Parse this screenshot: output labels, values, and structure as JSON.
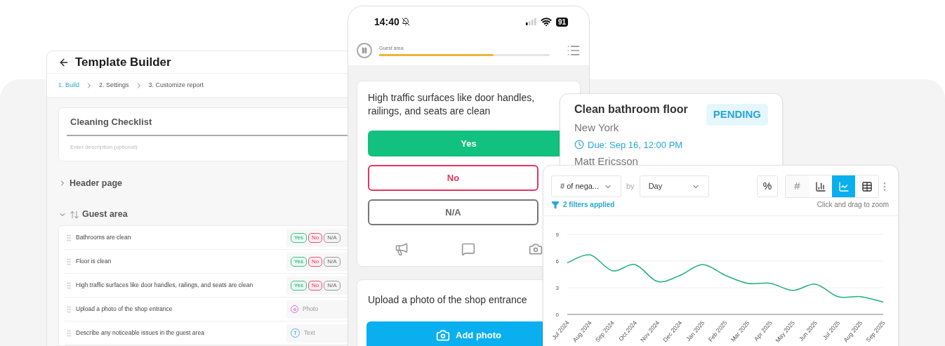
{
  "builder": {
    "title": "Template Builder",
    "steps": [
      {
        "label": "1. Build",
        "selected": true
      },
      {
        "label": "2. Settings",
        "selected": false
      },
      {
        "label": "3. Customize report",
        "selected": false
      }
    ],
    "template_name": "Cleaning Checklist",
    "description_placeholder": "Enter description (optional)",
    "sections": [
      {
        "title": "Header page",
        "expanded": false
      },
      {
        "title": "Guest area",
        "expanded": true,
        "items": [
          {
            "label": "Bathrooms are clean",
            "kind": "yes_no",
            "options": [
              "Yes",
              "No",
              "N/A"
            ]
          },
          {
            "label": "Floor is clean",
            "kind": "yes_no",
            "options": [
              "Yes",
              "No",
              "N/A"
            ]
          },
          {
            "label": "High traffic surfaces like door handles, railings, and seats are clean",
            "kind": "yes_no",
            "options": [
              "Yes",
              "No",
              "N/A"
            ]
          },
          {
            "label": "Upload a photo of the shop entrance",
            "kind": "photo",
            "type_label": "Photo"
          },
          {
            "label": "Describe any noticeable issues in the guest area",
            "kind": "text",
            "type_icon": "T",
            "type_label": "Text"
          }
        ]
      }
    ]
  },
  "phone": {
    "time": "14:40",
    "battery": "91",
    "section": "Guest area",
    "level": 0.67,
    "cards": [
      {
        "kind": "question",
        "text": "High traffic surfaces like door handles, railings, and seats are clean",
        "options": [
          {
            "label": "Yes",
            "kind": "positive",
            "selected": true
          },
          {
            "label": "No",
            "kind": "negative",
            "selected": false
          },
          {
            "label": "N/A",
            "kind": "neutral",
            "selected": false
          }
        ]
      },
      {
        "kind": "upload",
        "text": "Upload a photo of the shop entrance",
        "button": "Add photo"
      }
    ]
  },
  "task": {
    "title": "Clean bathroom floor",
    "location": "New York",
    "due": "Due: Sep 16, 12:00 PM",
    "assignee": "Matt Ericsson",
    "status": "PENDING"
  },
  "analytics": {
    "metric": "# of nega...",
    "by": "by",
    "interval": "Day",
    "percent": "%",
    "views": [
      {
        "kind": "count",
        "label": "#",
        "selected": false
      },
      {
        "kind": "bar",
        "selected": false
      },
      {
        "kind": "line",
        "selected": true
      },
      {
        "kind": "table",
        "selected": false
      }
    ],
    "filters": "2 filters applied",
    "hint": "Click and drag to zoom",
    "chart_data": {
      "type": "line",
      "categories": [
        "Jul 2024",
        "Aug 2024",
        "Sep 2024",
        "Oct 2024",
        "Nov 2024",
        "Dec 2024",
        "Jan 2025",
        "Feb 2025",
        "Mar 2025",
        "Apr 2025",
        "May 2025",
        "Jun 2025",
        "Jul 2025",
        "Aug 2025",
        "Sep 2025"
      ],
      "series": [
        {
          "color": "#22b07d",
          "values": [
            5.8,
            6.7,
            4.9,
            5.6,
            3.7,
            4.4,
            5.6,
            4.4,
            3.5,
            3.5,
            2.7,
            3.4,
            2.0,
            2.0,
            1.4
          ]
        }
      ],
      "ylim": [
        0,
        9
      ],
      "yticks": [
        0,
        3,
        6,
        9
      ]
    }
  }
}
